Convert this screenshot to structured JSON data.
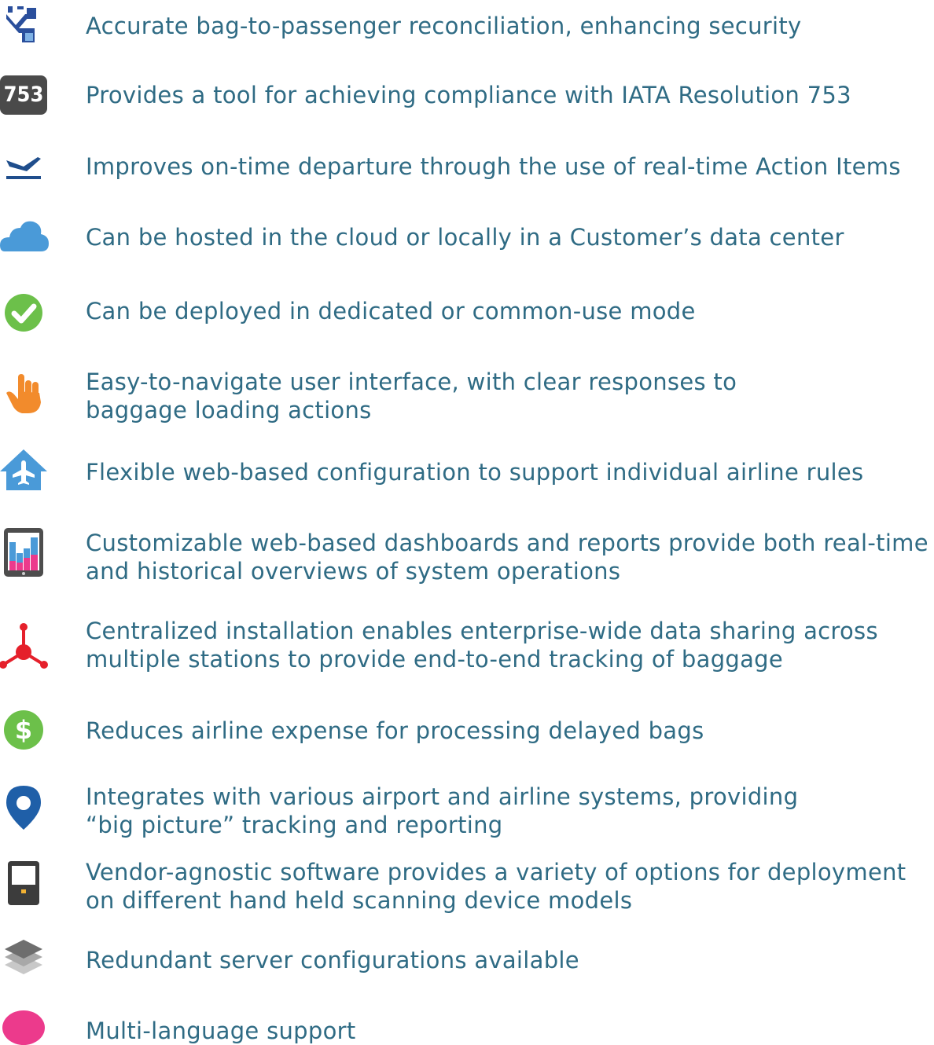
{
  "features": [
    {
      "icon": "bag-reconcile-icon",
      "lines": [
        "Accurate bag-to-passenger reconciliation, enhancing security"
      ]
    },
    {
      "icon": "iata-753-icon",
      "badge": "753",
      "lines": [
        "Provides a tool for achieving compliance with IATA Resolution 753"
      ]
    },
    {
      "icon": "departure-icon",
      "lines": [
        "Improves on-time departure through the use of real-time Action Items"
      ]
    },
    {
      "icon": "cloud-icon",
      "lines": [
        "Can be hosted in the cloud or locally in a Customer’s data center"
      ]
    },
    {
      "icon": "check-icon",
      "lines": [
        "Can be deployed in dedicated or common-use mode"
      ]
    },
    {
      "icon": "touch-hand-icon",
      "lines": [
        "Easy-to-navigate user interface, with clear responses to",
        "baggage loading actions"
      ]
    },
    {
      "icon": "airport-home-icon",
      "lines": [
        "Flexible web-based configuration to support individual airline rules"
      ]
    },
    {
      "icon": "tablet-chart-icon",
      "lines": [
        "Customizable web-based dashboards and reports provide both real-time",
        "and historical overviews of system operations"
      ]
    },
    {
      "icon": "network-hub-icon",
      "lines": [
        "Centralized installation enables enterprise-wide data sharing across",
        "multiple stations to provide end-to-end tracking of baggage"
      ]
    },
    {
      "icon": "dollar-icon",
      "badge": "$",
      "lines": [
        "Reduces airline expense for processing delayed bags"
      ]
    },
    {
      "icon": "location-pin-icon",
      "lines": [
        "Integrates with various airport and airline systems, providing",
        "“big picture” tracking and reporting"
      ]
    },
    {
      "icon": "handheld-scanner-icon",
      "lines": [
        "Vendor-agnostic software provides a variety of options for deployment",
        "on different hand held scanning device models"
      ]
    },
    {
      "icon": "server-layers-icon",
      "lines": [
        "Redundant server configurations available"
      ]
    },
    {
      "icon": "speech-bubble-icon",
      "lines": [
        "Multi-language support"
      ]
    }
  ],
  "colors": {
    "text": "#2f6b84",
    "navy": "#1f4e8c",
    "blue": "#4a9ad8",
    "green": "#6cc04a",
    "orange": "#f28b2c",
    "red": "#e5202b",
    "pink": "#ec3a8c",
    "dark": "#3c3c3c",
    "gray": "#8a8a8a"
  }
}
